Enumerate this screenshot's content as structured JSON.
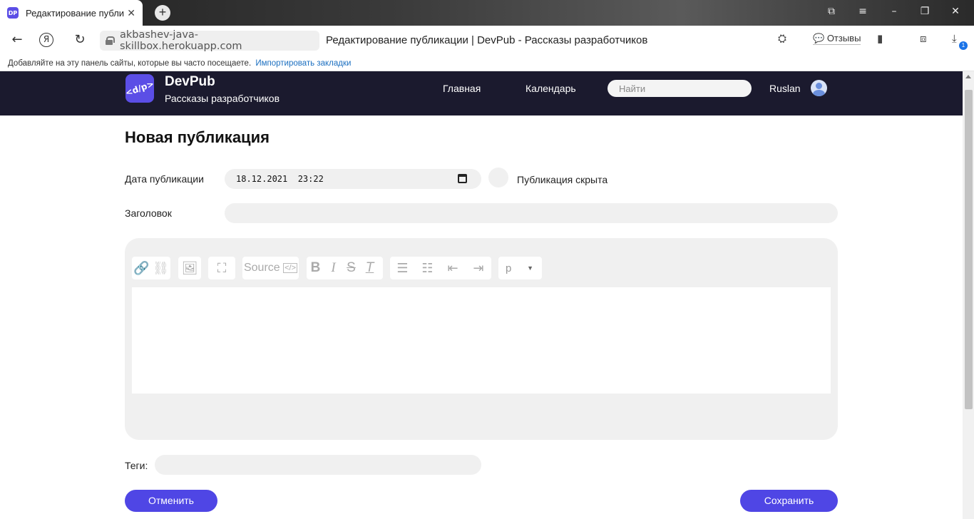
{
  "browser": {
    "tab_title": "Редактирование публи",
    "tab_favicon": "DP",
    "tab_close": "✕",
    "new_tab": "+",
    "url": "akbashev-java-skillbox.herokuapp.com",
    "page_title": "Редактирование публикации | DevPub - Рассказы разработчиков",
    "feedback_label": "Отзывы",
    "downloads_badge": "1",
    "bookmarks_hint": "Добавляйте на эту панель сайты, которые вы часто посещаете.",
    "bookmarks_import": "Импортировать закладки"
  },
  "header": {
    "logo_text": "<d/p>",
    "brand_name": "DevPub",
    "brand_tagline": "Рассказы разработчиков",
    "nav_home": "Главная",
    "nav_calendar": "Календарь",
    "search_placeholder": "Найти",
    "user_name": "Ruslan"
  },
  "form": {
    "heading": "Новая публикация",
    "date_label": "Дата публикации",
    "date_value": "18.12.2021  23:22",
    "hidden_label": "Публикация скрыта",
    "title_label": "Заголовок",
    "tags_label": "Теги:",
    "cancel_label": "Отменить",
    "save_label": "Сохранить"
  },
  "editor_toolbar": {
    "source_label": "Source",
    "format_value": "p"
  },
  "colors": {
    "header_bg": "#1b1a2e",
    "accent": "#4f46e5",
    "field_bg": "#f0f0f0"
  }
}
